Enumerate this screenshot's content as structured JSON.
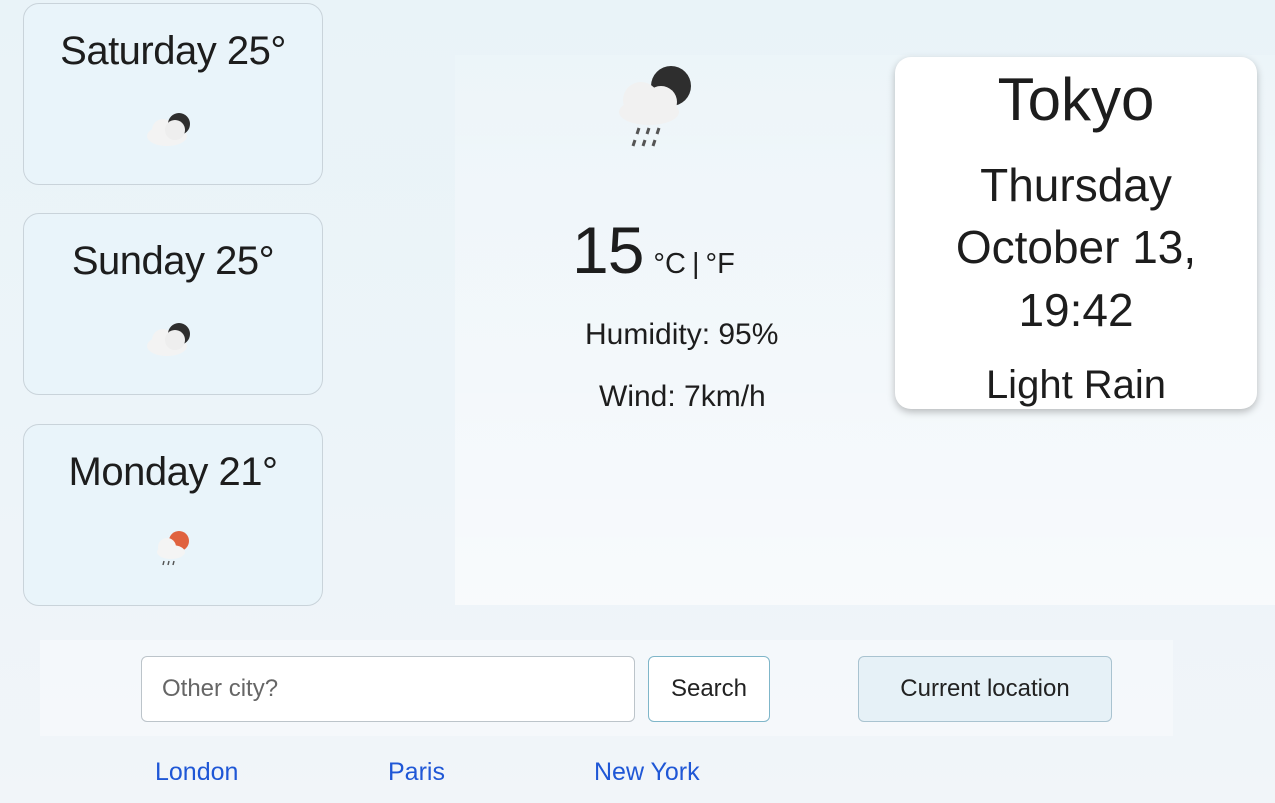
{
  "forecast": [
    {
      "label": "Saturday 25°",
      "icon": "night-cloudy-icon"
    },
    {
      "label": "Sunday 25°",
      "icon": "night-cloudy-icon"
    },
    {
      "label": "Monday 21°",
      "icon": "rain-sun-icon"
    }
  ],
  "current": {
    "icon": "night-rain-icon",
    "temperature": "15",
    "unit_c": "°C",
    "unit_sep": "|",
    "unit_f": "°F",
    "humidity": "Humidity: 95%",
    "wind": "Wind: 7km/h"
  },
  "city": {
    "name": "Tokyo",
    "day": "Thursday",
    "date": "October 13,",
    "time": "19:42",
    "description": "Light Rain"
  },
  "search": {
    "placeholder": "Other city?",
    "button_label": "Search",
    "location_label": "Current location"
  },
  "quick_links": [
    "London",
    "Paris",
    "New York"
  ],
  "colors": {
    "card_bg": "#e9f4fa",
    "link": "#1f57d6",
    "moon": "#2e2e2e",
    "sun": "#e0623f"
  }
}
